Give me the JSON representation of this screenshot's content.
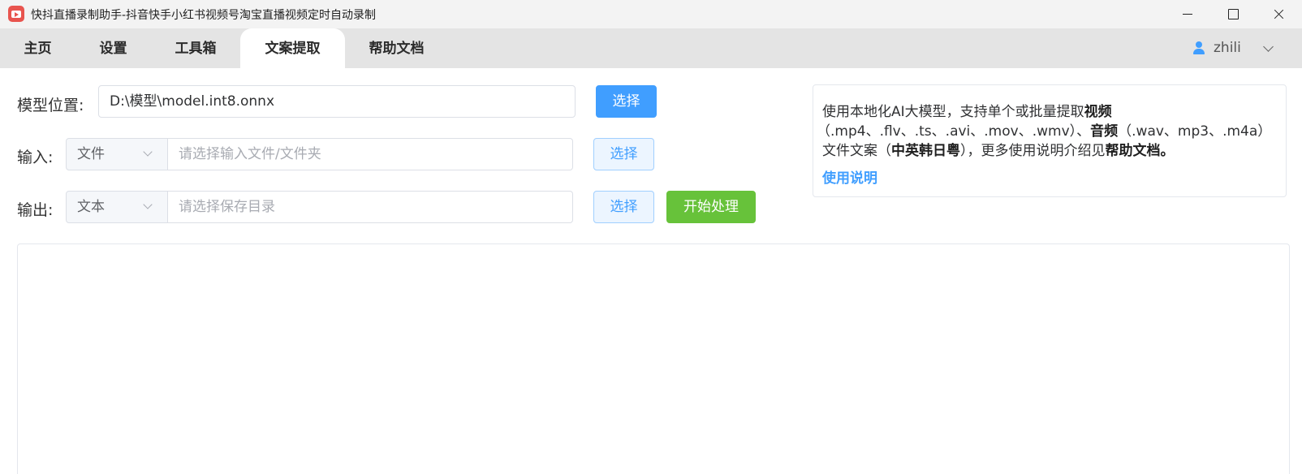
{
  "window": {
    "title": "快抖直播录制助手-抖音快手小红书视频号淘宝直播视频定时自动录制"
  },
  "tabs": [
    {
      "label": "主页"
    },
    {
      "label": "设置"
    },
    {
      "label": "工具箱"
    },
    {
      "label": "文案提取",
      "active": true
    },
    {
      "label": "帮助文档"
    }
  ],
  "user": {
    "name": "zhili"
  },
  "form": {
    "model": {
      "label": "模型位置:",
      "value": "D:\\模型\\model.int8.onnx",
      "button": "选择"
    },
    "input": {
      "label": "输入:",
      "type": "文件",
      "placeholder": "请选择输入文件/文件夹",
      "button": "选择"
    },
    "output": {
      "label": "输出:",
      "type": "文本",
      "placeholder": "请选择保存目录",
      "button": "选择",
      "start_button": "开始处理"
    }
  },
  "info": {
    "line1": {
      "text": "使用本地化AI大模型，支持单个或批量提取",
      "bold": "视频"
    },
    "line2": {
      "text1": "（.mp4、.flv、.ts、.avi、.mov、.wmv）、",
      "bold": "音频",
      "text2": "（.wav、mp3、.m4a）"
    },
    "line3": {
      "text1": "文件文案（",
      "bold1": "中英韩日粤",
      "text2": "），更多使用说明介绍见",
      "bold2": "帮助文档。"
    },
    "link": "使用说明"
  },
  "colors": {
    "primary": "#409eff",
    "success": "#67c23a",
    "tabbar_bg": "#e4e4e4",
    "titlebar_bg": "#f3f3f3"
  }
}
